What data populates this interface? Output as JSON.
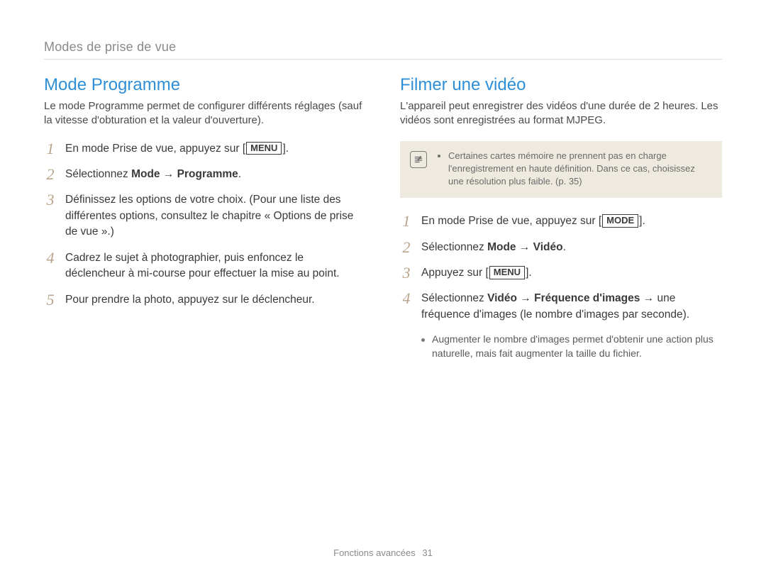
{
  "breadcrumb": "Modes de prise de vue",
  "footer": {
    "label": "Fonctions avancées",
    "page": "31"
  },
  "left": {
    "title": "Mode Programme",
    "intro": "Le mode Programme permet de configurer différents réglages (sauf la vitesse d'obturation et la valeur d'ouverture).",
    "steps": {
      "s1": {
        "num": "1",
        "pre": "En mode Prise de vue, appuyez sur [",
        "btn": "MENU",
        "post": "]."
      },
      "s2": {
        "num": "2",
        "pre": "Sélectionnez ",
        "b1": "Mode",
        "arrow": " → ",
        "b2": "Programme",
        "post": "."
      },
      "s3": {
        "num": "3",
        "text": "Définissez les options de votre choix. (Pour une liste des différentes options, consultez le chapitre « Options de prise de vue ».)"
      },
      "s4": {
        "num": "4",
        "text": "Cadrez le sujet à photographier, puis enfoncez le déclencheur à mi-course pour effectuer la mise au point."
      },
      "s5": {
        "num": "5",
        "text": "Pour prendre la photo, appuyez sur le déclencheur."
      }
    }
  },
  "right": {
    "title": "Filmer une vidéo",
    "intro": "L'appareil peut enregistrer des vidéos d'une durée de 2 heures. Les vidéos sont enregistrées au format MJPEG.",
    "note": "Certaines cartes mémoire ne prennent pas en charge l'enregistrement en haute définition. Dans ce cas, choisissez une résolution plus faible. (p. 35)",
    "steps": {
      "s1": {
        "num": "1",
        "pre": "En mode Prise de vue, appuyez sur [",
        "btn": "MODE",
        "post": "]."
      },
      "s2": {
        "num": "2",
        "pre": "Sélectionnez ",
        "b1": "Mode",
        "arrow": " → ",
        "b2": "Vidéo",
        "post": "."
      },
      "s3": {
        "num": "3",
        "pre": "Appuyez sur [",
        "btn": "MENU",
        "post": "]."
      },
      "s4": {
        "num": "4",
        "pre": "Sélectionnez ",
        "b1": "Vidéo",
        "arrow1": " → ",
        "b2": "Fréquence d'images",
        "arrow2": " → ",
        "tail": "une fréquence d'images (le nombre d'images par seconde)."
      },
      "sub": "Augmenter le nombre d'images permet d'obtenir une action plus naturelle, mais fait augmenter la taille du fichier."
    }
  }
}
